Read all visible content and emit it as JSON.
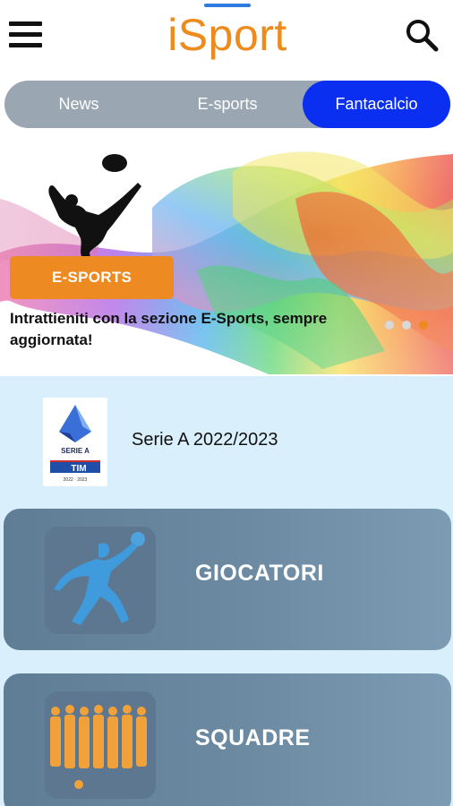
{
  "header": {
    "brand": "iSport",
    "menu_icon": "hamburger-menu-icon",
    "search_icon": "search-icon"
  },
  "tabs": [
    {
      "label": "News",
      "active": false
    },
    {
      "label": "E-sports",
      "active": false
    },
    {
      "label": "Fantacalcio",
      "active": true
    }
  ],
  "banner": {
    "badge": "E-SPORTS",
    "caption": "Intrattieniti con la sezione E-Sports, sempre aggiornata!",
    "slides_total": 3,
    "active_slide": 3
  },
  "league": {
    "name": "Serie A 2022/2023",
    "logo_text": "SERIE A",
    "logo_sponsor": "TIM",
    "logo_years": "2022 · 2023"
  },
  "cards": [
    {
      "label": "GIOCATORI",
      "icon": "football-player-icon"
    },
    {
      "label": "SQUADRE",
      "icon": "team-lineup-icon"
    }
  ],
  "colors": {
    "brand_orange": "#ef8a1d",
    "active_tab": "#0b2ff0",
    "tab_track": "#9aa7b2",
    "content_bg": "#d9effb",
    "card_bg": "#6c8ba3"
  }
}
